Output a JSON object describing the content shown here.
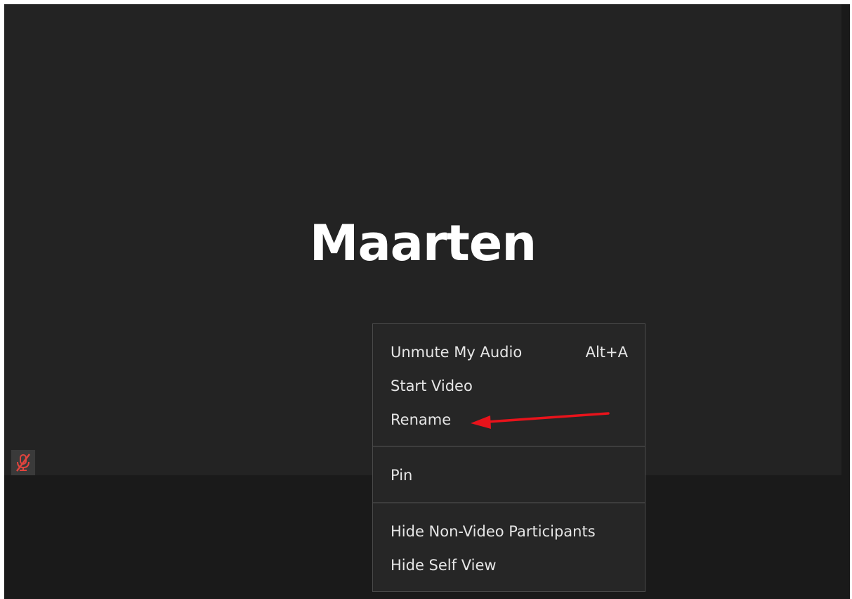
{
  "participant": {
    "name": "Maarten",
    "audio_icon": "microphone-muted-icon"
  },
  "context_menu": {
    "groups": [
      {
        "items": [
          {
            "label": "Unmute My Audio",
            "shortcut": "Alt+A"
          },
          {
            "label": "Start Video",
            "shortcut": ""
          },
          {
            "label": "Rename",
            "shortcut": ""
          }
        ]
      },
      {
        "items": [
          {
            "label": "Pin",
            "shortcut": ""
          }
        ]
      },
      {
        "items": [
          {
            "label": "Hide Non-Video Participants",
            "shortcut": ""
          },
          {
            "label": "Hide Self View",
            "shortcut": ""
          }
        ]
      }
    ]
  },
  "colors": {
    "tile_background": "#232323",
    "menu_background": "#262626",
    "muted_icon": "#e0443e",
    "annotation_arrow": "#e8131b"
  }
}
